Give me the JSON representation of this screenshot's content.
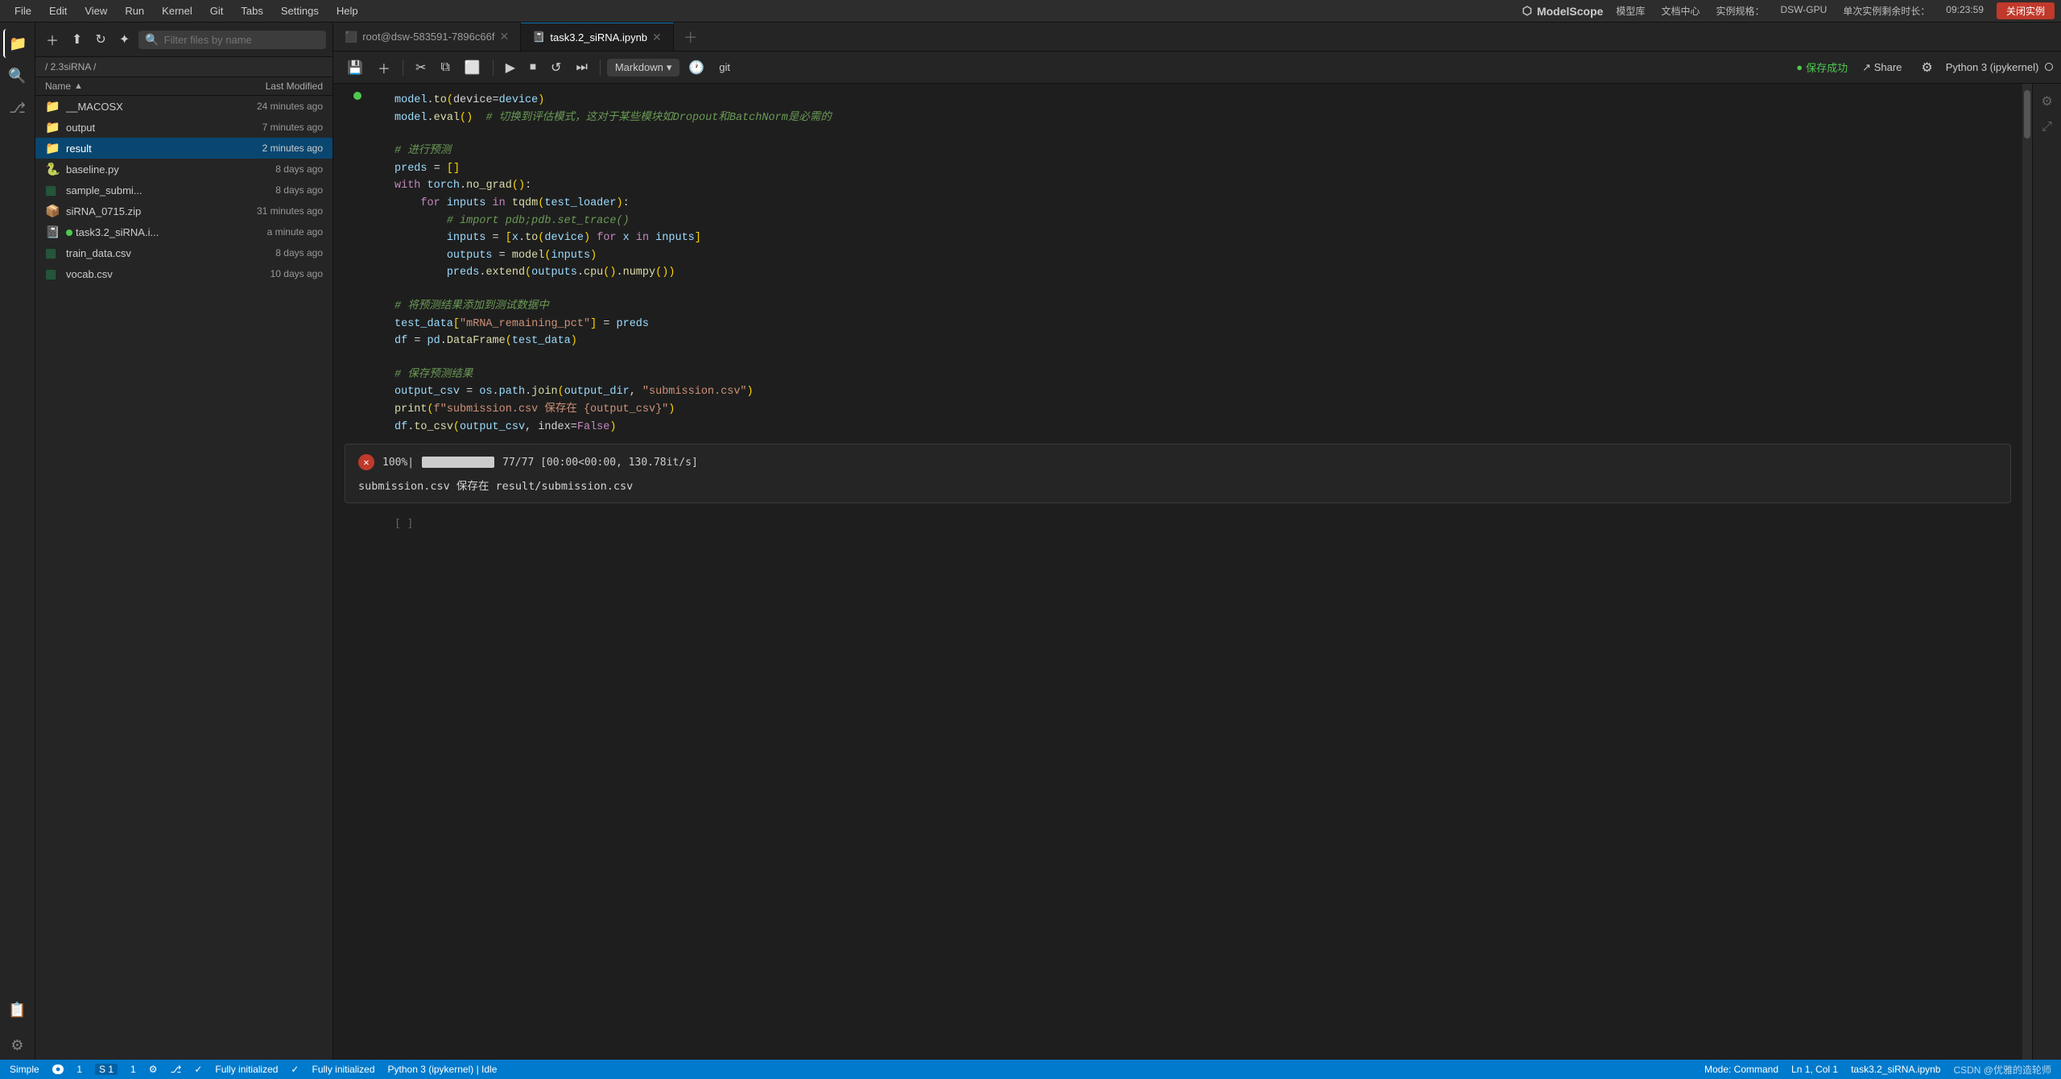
{
  "menubar": {
    "items": [
      "File",
      "Edit",
      "View",
      "Run",
      "Kernel",
      "Git",
      "Tabs",
      "Settings",
      "Help"
    ],
    "logo": "ModelScope",
    "logo_chinese": "模型库",
    "docs": "文档中心",
    "instance_label": "实例规格：",
    "instance_type": "DSW-GPU",
    "timer_label": "单次实例剩余时长：",
    "timer_value": "09:23:59",
    "close_label": "关闭实例"
  },
  "sidebar": {
    "icons": [
      "📁",
      "🔍",
      "⎇",
      "📋",
      "⚙"
    ]
  },
  "file_panel": {
    "toolbar": {
      "new_folder": "+",
      "upload": "⬆",
      "refresh": "↻",
      "more": "✦"
    },
    "search_placeholder": "Filter files by name",
    "breadcrumb": "/ 2.3siRNA /",
    "columns": {
      "name": "Name",
      "modified": "Last Modified"
    },
    "files": [
      {
        "name": "__MACOSX",
        "type": "folder",
        "icon": "📁",
        "modified": "24 minutes ago"
      },
      {
        "name": "output",
        "type": "folder",
        "icon": "📁",
        "modified": "7 minutes ago"
      },
      {
        "name": "result",
        "type": "folder",
        "icon": "📁",
        "modified": "2 minutes ago",
        "selected": true
      },
      {
        "name": "baseline.py",
        "type": "python",
        "icon": "🐍",
        "modified": "8 days ago"
      },
      {
        "name": "sample_submi...",
        "type": "csv",
        "icon": "📊",
        "modified": "8 days ago"
      },
      {
        "name": "siRNA_0715.zip",
        "type": "zip",
        "icon": "📦",
        "modified": "31 minutes ago"
      },
      {
        "name": "task3.2_siRNA.i...",
        "type": "notebook",
        "icon": "📓",
        "modified": "a minute ago",
        "dot": true
      },
      {
        "name": "train_data.csv",
        "type": "csv",
        "icon": "📊",
        "modified": "8 days ago"
      },
      {
        "name": "vocab.csv",
        "type": "csv",
        "icon": "📊",
        "modified": "10 days ago"
      }
    ]
  },
  "tabs": {
    "items": [
      {
        "id": "terminal",
        "label": "root@dsw-583591-7896c66f",
        "icon": "⬛",
        "active": false
      },
      {
        "id": "notebook",
        "label": "task3.2_siRNA.ipynb",
        "icon": "📓",
        "active": true
      }
    ]
  },
  "notebook_toolbar": {
    "save": "💾",
    "add_cell": "+",
    "cut": "✂",
    "copy": "⧉",
    "paste": "⬜",
    "run": "▶",
    "stop": "⏹",
    "restart": "↺",
    "fast_forward": "⏭",
    "cell_type": "Markdown",
    "clock": "🕐",
    "git": "git",
    "save_success": "保存成功",
    "share": "Share",
    "kernel": "Python 3 (ipykernel)"
  },
  "code_cells": [
    {
      "id": "cell1",
      "counter": "",
      "lines": [
        {
          "text": "model.to(device=device)",
          "type": "code"
        },
        {
          "text": "model.eval()  # 切换到评估模式，这对于某些模块如Dropout和BatchNorm是必需的",
          "type": "comment_mixed"
        }
      ]
    },
    {
      "id": "cell2",
      "counter": "",
      "lines": [
        {
          "text": "# 进行预测",
          "type": "comment"
        },
        {
          "text": "preds = []",
          "type": "code"
        },
        {
          "text": "with torch.no_grad():",
          "type": "code"
        },
        {
          "text": "    for inputs in tqdm(test_loader):",
          "type": "code"
        },
        {
          "text": "        # import pdb;pdb.set_trace()",
          "type": "comment"
        },
        {
          "text": "        inputs = [x.to(device) for x in inputs]",
          "type": "code"
        },
        {
          "text": "        outputs = model(inputs)",
          "type": "code"
        },
        {
          "text": "        preds.extend(outputs.cpu().numpy())",
          "type": "code"
        }
      ]
    },
    {
      "id": "cell3",
      "counter": "",
      "lines": [
        {
          "text": "# 将预测结果添加到测试数据中",
          "type": "comment"
        },
        {
          "text": "test_data[\"mRNA_remaining_pct\"] = preds",
          "type": "code"
        },
        {
          "text": "df = pd.DataFrame(test_data)",
          "type": "code"
        }
      ]
    },
    {
      "id": "cell4",
      "counter": "",
      "lines": [
        {
          "text": "# 保存预测结果",
          "type": "comment"
        },
        {
          "text": "output_csv = os.path.join(output_dir, \"submission.csv\")",
          "type": "code"
        },
        {
          "text": "print(f\"submission.csv 保存在 {output_csv}\")",
          "type": "code"
        },
        {
          "text": "df.to_csv(output_csv, index=False)",
          "type": "code"
        }
      ]
    }
  ],
  "output": {
    "progress": "100%|",
    "bar_fill": 100,
    "stats": " 77/77 [00:00<00:00, 130.78it/s]",
    "message": "submission.csv 保存在 result/submission.csv"
  },
  "empty_cell": "[ ]",
  "status_bar": {
    "mode": "Simple",
    "toggle": "●",
    "line_col": "1",
    "item1": "S 1",
    "item2": "1",
    "git_branch": "",
    "initialized1": "Fully initialized",
    "initialized2": "Fully initialized",
    "kernel": "Python 3 (ipykernel) | Idle",
    "mode_label": "Mode: Command",
    "position": "Ln 1, Col 1",
    "filename": "task3.2_siRNA.ipynb",
    "brand": "CSDN @优雅的造轮师"
  }
}
